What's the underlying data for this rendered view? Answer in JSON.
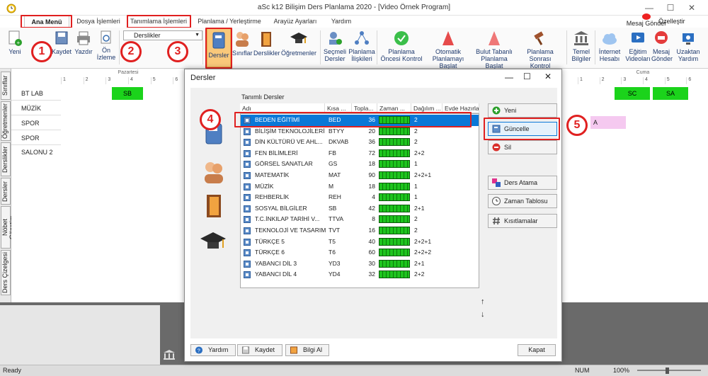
{
  "window": {
    "title": "aSc k12 Bilişim Ders Planlama 2020 - [Video Örnek Program]"
  },
  "tabs": [
    {
      "label": "Ana Menü",
      "active": true
    },
    {
      "label": "Dosya İşlemleri"
    },
    {
      "label": "Tanımlama İşlemleri"
    },
    {
      "label": "Planlama / Yerleştirme"
    },
    {
      "label": "Arayüz Ayarları"
    },
    {
      "label": "Yardım"
    }
  ],
  "ribbon_right": {
    "mesaj_gonder": "Mesaj Gönder",
    "ozellestir": "Özelleştir"
  },
  "ribbon": {
    "yeni": "Yeni",
    "kaydet": "Kaydet",
    "yazdir": "Yazdır",
    "on_izleme_1": "Ön",
    "on_izleme_2": "İzleme",
    "dropdown": "Derslikler",
    "dersler": "Dersler",
    "siniflar": "Sınıflar",
    "derslikler": "Derslikler",
    "ogretmenler": "Öğretmenler",
    "secmeli_1": "Seçmeli",
    "secmeli_2": "Dersler",
    "iliskiler_1": "Planlama",
    "iliskiler_2": "İlişkileri",
    "oncesi_1": "Planlama",
    "oncesi_2": "Öncesi Kontrol",
    "otomatik_1": "Otomatik",
    "otomatik_2": "Planlamayı Başlat",
    "bulut_1": "Bulut Tabanlı",
    "bulut_2": "Planlama Başlat",
    "sonrasi_1": "Planlama Sonrası",
    "sonrasi_2": "Kontrol",
    "temel_1": "Temel",
    "temel_2": "Bilgiler",
    "internet_1": "İnternet",
    "internet_2": "Hesabı",
    "egitim_1": "Eğitim",
    "egitim_2": "Videoları",
    "mesaj_1": "Mesaj",
    "mesaj_2": "Gönder",
    "uzaktan_1": "Uzaktan",
    "uzaktan_2": "Yardım"
  },
  "callouts": [
    "1",
    "2",
    "3",
    "4",
    "5"
  ],
  "side_tabs": [
    "Sınıflar",
    "Öğretmenler",
    "Derslikler",
    "Dersler",
    "Nöbet Gözetim",
    "Ders Çizelgesi"
  ],
  "grid": {
    "day_left": "Pazartesi",
    "day_right": "Cuma",
    "period_numbers": [
      "1",
      "2",
      "3",
      "4",
      "5",
      "6"
    ],
    "rows": [
      "BT LAB",
      "MÜZİK",
      "SPOR SALONU",
      "SPOR SALONU 2"
    ],
    "cells": {
      "bt_left": "SB",
      "bt_r1": "SC",
      "bt_r2": "SA",
      "spor_r": "A"
    }
  },
  "dialog": {
    "title": "Dersler",
    "section_label": "Tanımlı Dersler",
    "columns": [
      "Adı",
      "Kısa ...",
      "Topla...",
      "Zaman ...",
      "Dağılım ...",
      "Evde Hazırla"
    ],
    "rows": [
      {
        "name": "BEDEN EĞİTİMİ",
        "short": "BED",
        "total": "36",
        "dist": "2",
        "selected": true
      },
      {
        "name": "BİLİŞİM TEKNOLOJİLERİ",
        "short": "BTYY",
        "total": "20",
        "dist": "2"
      },
      {
        "name": "DİN KÜLTÜRÜ VE AHL...",
        "short": "DKVAB",
        "total": "36",
        "dist": "2"
      },
      {
        "name": "FEN BİLİMLERİ",
        "short": "FB",
        "total": "72",
        "dist": "2+2"
      },
      {
        "name": "GÖRSEL SANATLAR",
        "short": "GS",
        "total": "18",
        "dist": "1"
      },
      {
        "name": "MATEMATİK",
        "short": "MAT",
        "total": "90",
        "dist": "2+2+1"
      },
      {
        "name": "MÜZİK",
        "short": "M",
        "total": "18",
        "dist": "1"
      },
      {
        "name": "REHBERLİK",
        "short": "REH",
        "total": "4",
        "dist": "1"
      },
      {
        "name": "SOSYAL BİLGİLER",
        "short": "SB",
        "total": "42",
        "dist": "2+1"
      },
      {
        "name": "T.C.İNKILAP TARİHİ V...",
        "short": "TTVA",
        "total": "8",
        "dist": "2"
      },
      {
        "name": "TEKNOLOJİ VE TASARIM",
        "short": "TVT",
        "total": "16",
        "dist": "2"
      },
      {
        "name": "TÜRKÇE 5",
        "short": "T5",
        "total": "40",
        "dist": "2+2+1"
      },
      {
        "name": "TÜRKÇE 6",
        "short": "T6",
        "total": "60",
        "dist": "2+2+2"
      },
      {
        "name": "YABANCI DİL 3",
        "short": "YD3",
        "total": "30",
        "dist": "2+1"
      },
      {
        "name": "YABANCI DİL 4",
        "short": "YD4",
        "total": "32",
        "dist": "2+2"
      }
    ],
    "buttons": {
      "yeni": "Yeni",
      "guncelle": "Güncelle",
      "sil": "Sil",
      "ders_atama": "Ders Atama",
      "zaman_tablosu": "Zaman Tablosu",
      "kisitlamalar": "Kısıtlamalar"
    },
    "footer": {
      "yardim": "Yardım",
      "kaydet": "Kaydet",
      "bilgi_al": "Bilgi Al",
      "kapat": "Kapat"
    },
    "arrows": {
      "up": "↑",
      "down": "↓"
    }
  },
  "status": {
    "left": "Ready",
    "num": "NUM",
    "zoom": "100%"
  }
}
